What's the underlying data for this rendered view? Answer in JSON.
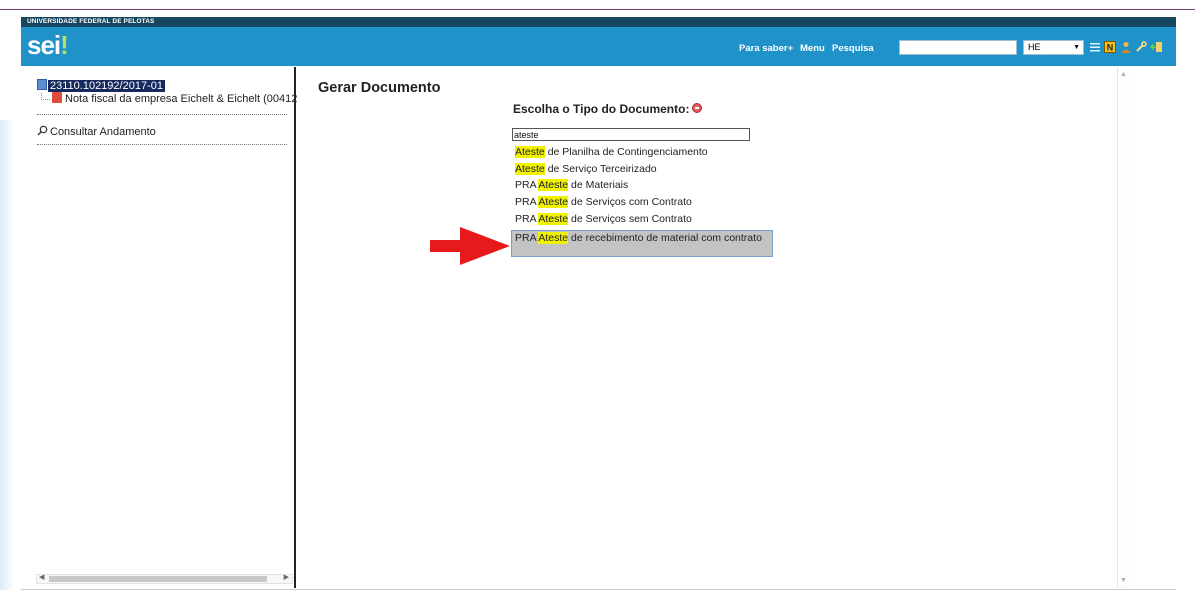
{
  "header": {
    "org_name": "UNIVERSIDADE FEDERAL DE PELOTAS",
    "logo_text": "sei",
    "logo_dot": "!",
    "links": {
      "saber_mais": "Para saber+",
      "menu": "Menu",
      "pesquisa": "Pesquisa"
    },
    "search_value": "",
    "unit_selected": "HE",
    "icons": [
      "list-icon",
      "notepad-icon",
      "user-icon",
      "wrench-icon",
      "exit-icon"
    ]
  },
  "tree": {
    "process_number": "23110.102192/2017-01",
    "document_label": "Nota fiscal da empresa Eichelt & Eichelt (00412",
    "consult_label": "Consultar Andamento"
  },
  "main": {
    "title": "Gerar Documento",
    "choose_label": "Escolha o Tipo do Documento:",
    "filter_value": "ateste",
    "options": [
      {
        "prefix": "",
        "highlight": "Ateste",
        "suffix": " de Planilha de Contingenciamento"
      },
      {
        "prefix": "",
        "highlight": "Ateste",
        "suffix": " de Serviço Terceirizado"
      },
      {
        "prefix": "PRA ",
        "highlight": "Ateste",
        "suffix": " de Materiais"
      },
      {
        "prefix": "PRA ",
        "highlight": "Ateste",
        "suffix": " de Serviços com Contrato"
      },
      {
        "prefix": "PRA ",
        "highlight": "Ateste",
        "suffix": " de Serviços sem Contrato"
      },
      {
        "prefix": "PRA ",
        "highlight": "Ateste",
        "suffix": " de recebimento de material com contrato"
      }
    ]
  },
  "colors": {
    "header_blue": "#1f92c9",
    "org_bar": "#15465f",
    "highlight_yellow": "#f1f200",
    "arrow_red": "#e8191b",
    "selected_bg": "#c3c3c3"
  }
}
